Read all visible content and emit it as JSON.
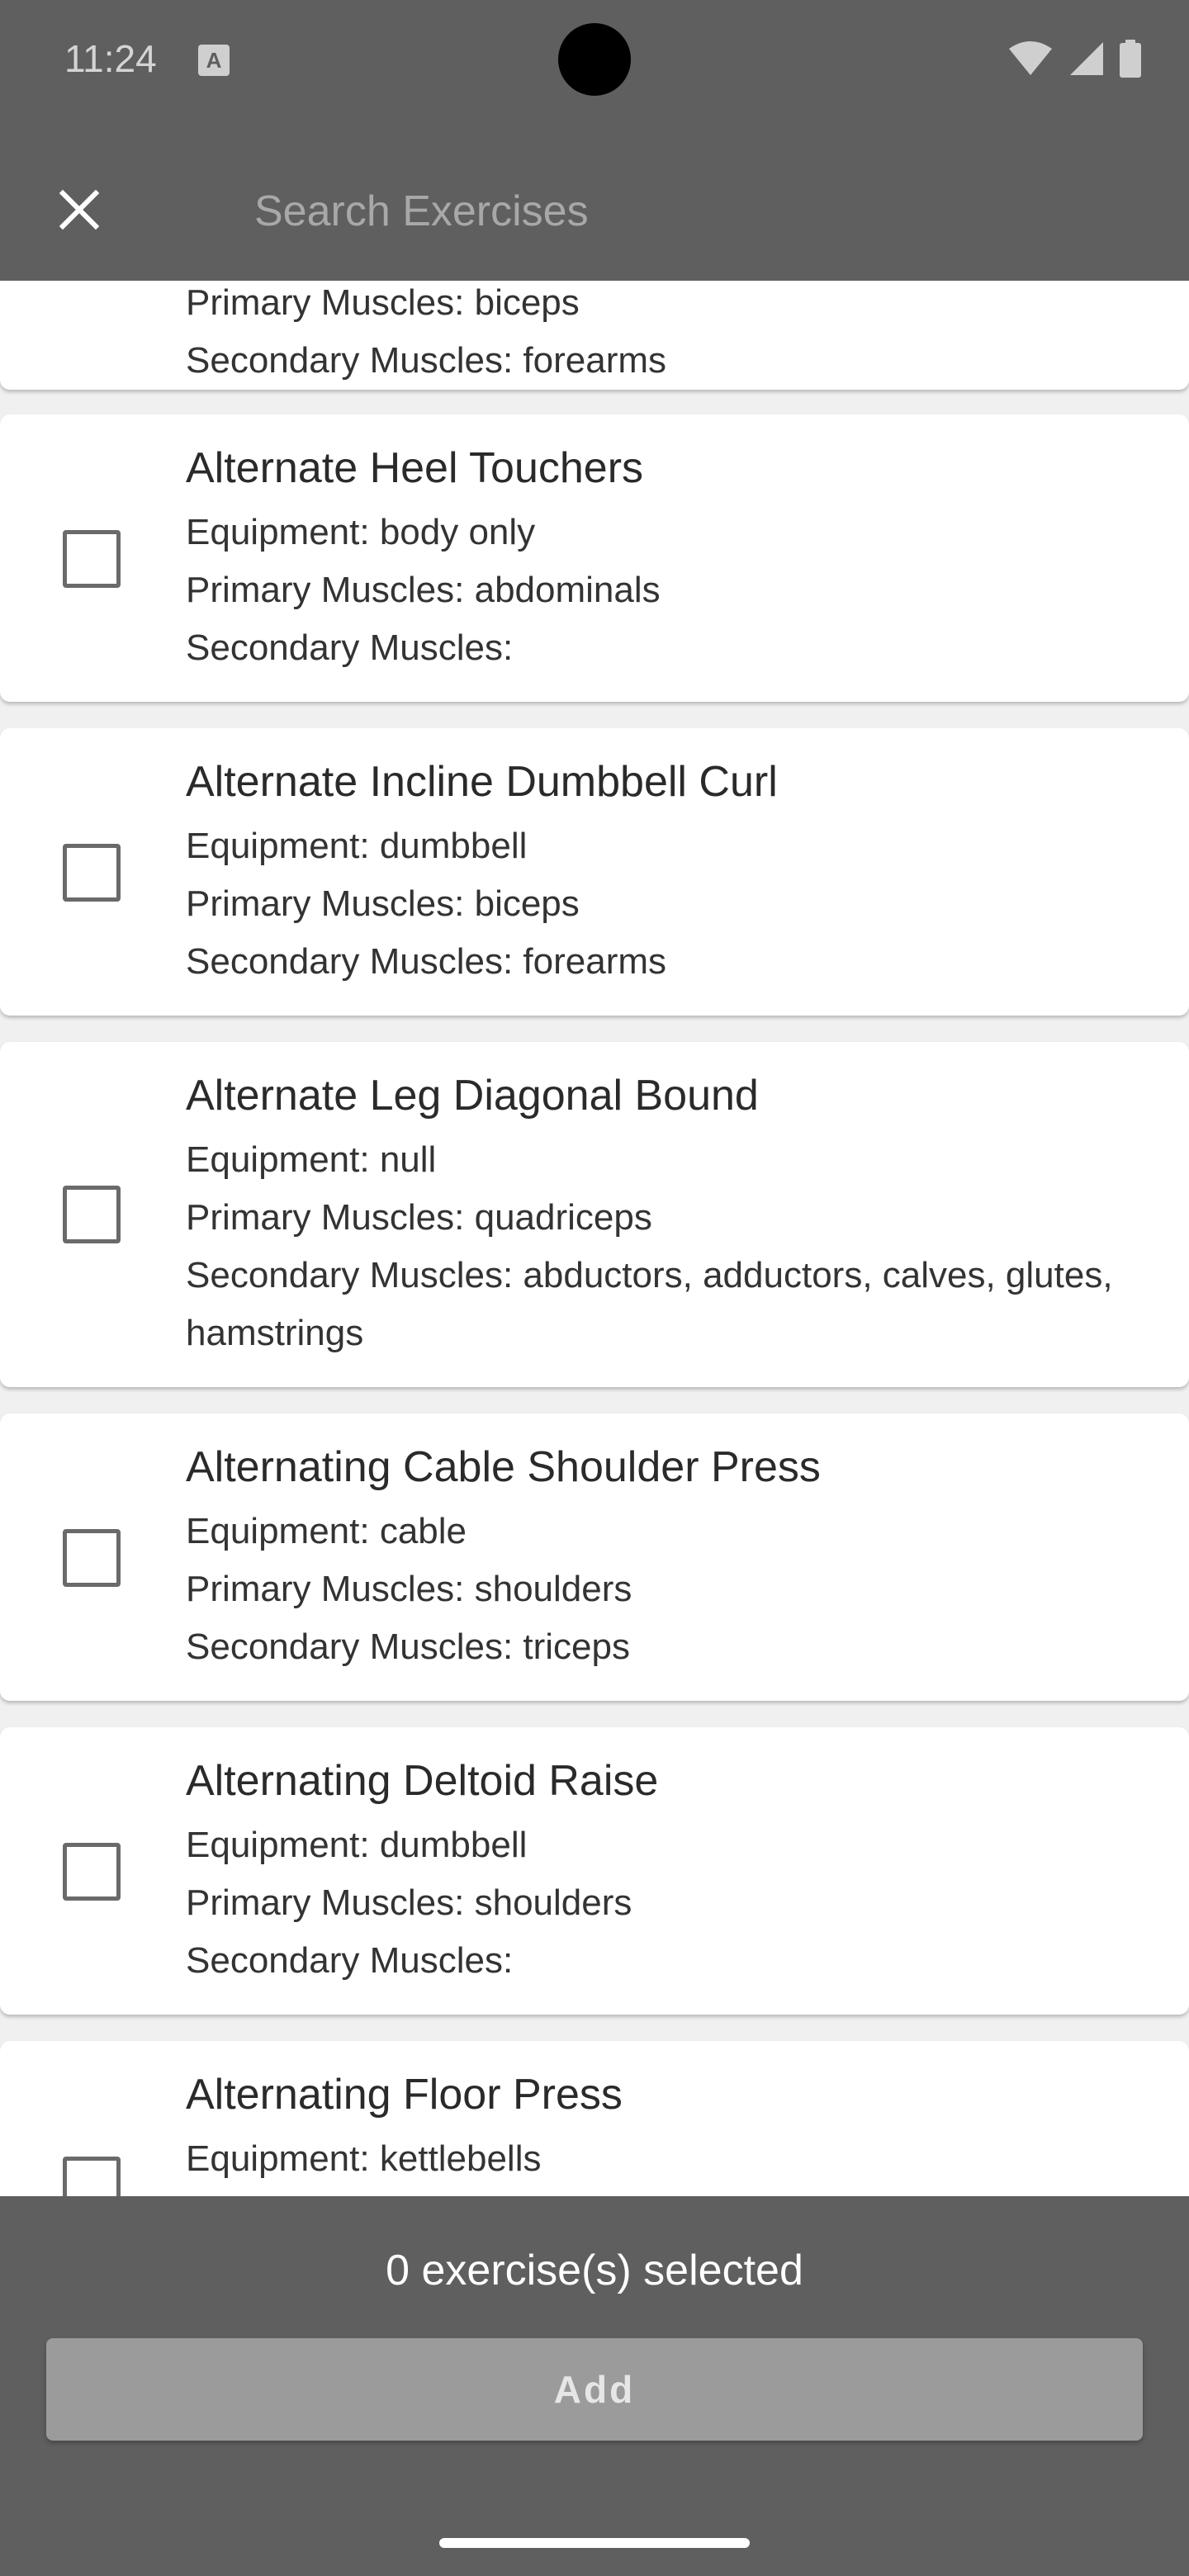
{
  "status_bar": {
    "time": "11:24",
    "notification_icon": "a-badge-icon",
    "icons": [
      "wifi-icon",
      "signal-icon",
      "battery-icon"
    ]
  },
  "app_bar": {
    "close_icon": "close-icon",
    "search_placeholder": "Search Exercises",
    "search_value": ""
  },
  "labels": {
    "equipment": "Equipment: ",
    "primary": "Primary Muscles: ",
    "secondary": "Secondary Muscles: "
  },
  "exercises": [
    {
      "name": "",
      "equipment": "",
      "primary": "biceps",
      "secondary": "forearms"
    },
    {
      "name": "Alternate Heel Touchers",
      "equipment": "body only",
      "primary": "abdominals",
      "secondary": ""
    },
    {
      "name": "Alternate Incline Dumbbell Curl",
      "equipment": "dumbbell",
      "primary": "biceps",
      "secondary": "forearms"
    },
    {
      "name": "Alternate Leg Diagonal Bound",
      "equipment": "null",
      "primary": "quadriceps",
      "secondary": "abductors, adductors, calves, glutes, hamstrings"
    },
    {
      "name": "Alternating Cable Shoulder Press",
      "equipment": "cable",
      "primary": "shoulders",
      "secondary": "triceps"
    },
    {
      "name": "Alternating Deltoid Raise",
      "equipment": "dumbbell",
      "primary": "shoulders",
      "secondary": ""
    },
    {
      "name": "Alternating Floor Press",
      "equipment": "kettlebells",
      "primary": "",
      "secondary": ""
    }
  ],
  "footer": {
    "selected_text": "0 exercise(s) selected",
    "add_label": "Add"
  },
  "colors": {
    "bar_background": "#5f5f5f",
    "card_background": "#ffffff",
    "add_button_disabled": "#9b9b9b"
  }
}
